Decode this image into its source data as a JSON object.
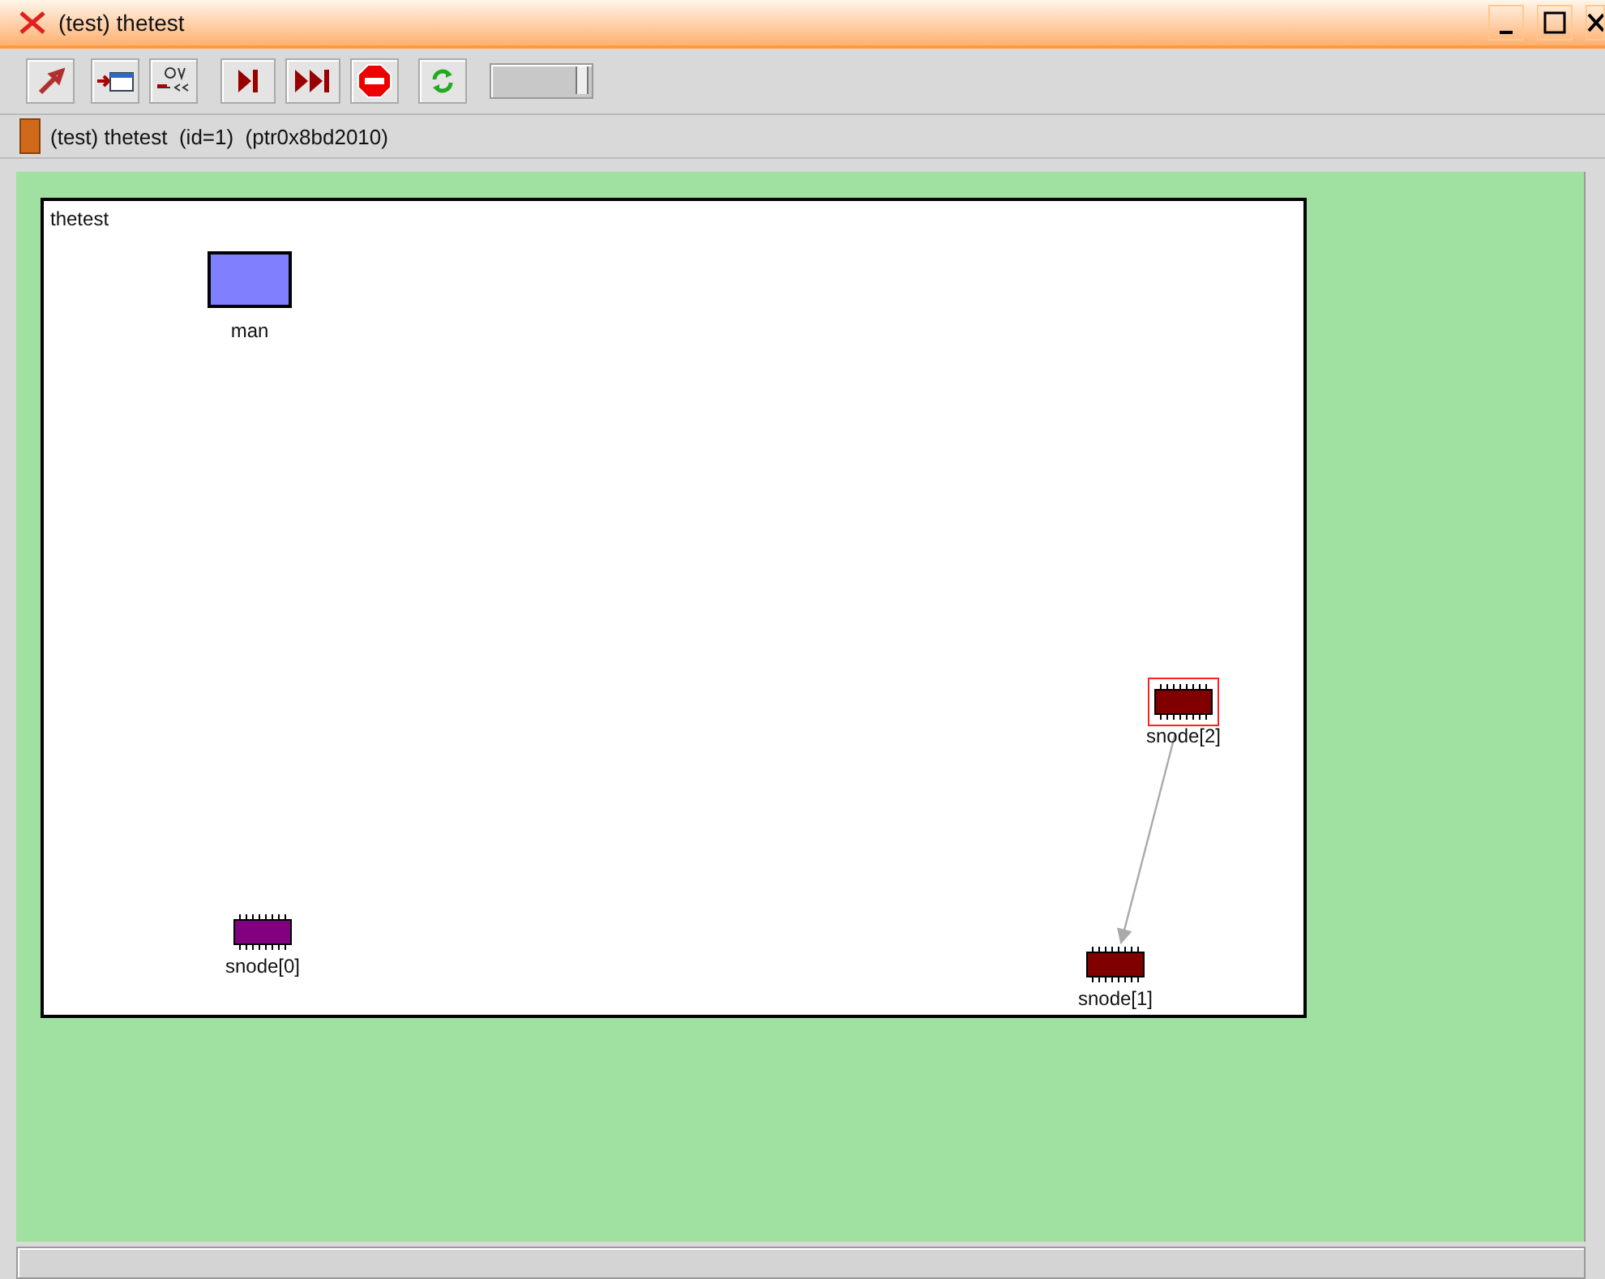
{
  "window": {
    "title": "(test) thetest"
  },
  "toolbar": {
    "slider": {
      "level": 0.97
    }
  },
  "status": {
    "text": "(test) thetest  (id=1)  (ptr0x8bd2010)"
  },
  "canvas": {
    "module_title": "thetest",
    "nodes": [
      {
        "label": "man",
        "kind": "module",
        "color": "#8080ff",
        "selected": false
      },
      {
        "label": "snode[0]",
        "kind": "chip",
        "color": "#800080",
        "selected": false
      },
      {
        "label": "snode[1]",
        "kind": "chip",
        "color": "#800000",
        "selected": false
      },
      {
        "label": "snode[2]",
        "kind": "chip",
        "color": "#800000",
        "selected": true
      }
    ],
    "links": [
      {
        "kind": "arrow"
      }
    ]
  }
}
